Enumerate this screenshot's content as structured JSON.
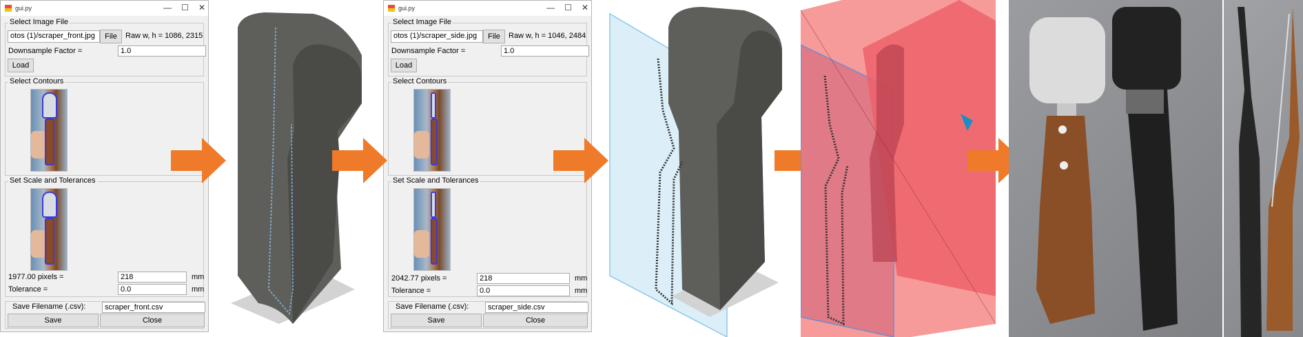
{
  "colors": {
    "arrow": "#ee7a2a",
    "cad_model": "#5c5c58",
    "plane_red": "#f25a5a",
    "plane_blue": "#cfe9f7",
    "wood": "#8a4f26"
  },
  "window_front": {
    "title": "gui.py",
    "select_image_file_label": "Select Image File",
    "file_path": "otos (1)/scraper_front.jpg",
    "file_button": "File",
    "raw_dims": "Raw w, h = 1086, 2315",
    "downsample_label": "Downsample Factor =",
    "downsample_value": "1.0",
    "load_button": "Load",
    "select_contours_label": "Select Contours",
    "scale_group_label": "Set Scale and Tolerances",
    "pixels_label": "1977.00 pixels =",
    "pixels_value": "218",
    "pixels_unit": "mm",
    "tolerance_label": "Tolerance =",
    "tolerance_value": "0.0",
    "tolerance_unit": "mm",
    "save_filename_label": "Save Filename (.csv):",
    "save_filename_value": "scraper_front.csv",
    "save_button": "Save",
    "close_button": "Close"
  },
  "window_side": {
    "title": "gui.py",
    "select_image_file_label": "Select Image File",
    "file_path": "otos (1)/scraper_side.jpg",
    "file_button": "File",
    "raw_dims": "Raw w, h = 1046, 2484",
    "downsample_label": "Downsample Factor =",
    "downsample_value": "1.0",
    "load_button": "Load",
    "select_contours_label": "Select Contours",
    "scale_group_label": "Set Scale and Tolerances",
    "pixels_label": "2042.77 pixels =",
    "pixels_value": "218",
    "pixels_unit": "mm",
    "tolerance_label": "Tolerance =",
    "tolerance_value": "0.0",
    "tolerance_unit": "mm",
    "save_filename_label": "Save Filename (.csv):",
    "save_filename_value": "scraper_side.csv",
    "save_button": "Save",
    "close_button": "Close"
  },
  "icons": {
    "window_controls": [
      "minimize-icon",
      "maximize-icon",
      "close-icon"
    ],
    "flow": "arrow-right-icon"
  }
}
